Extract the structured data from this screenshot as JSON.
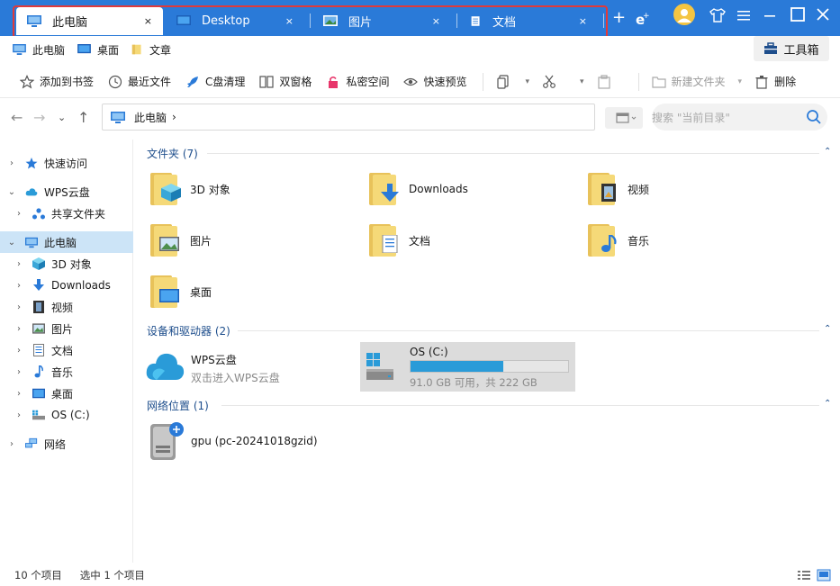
{
  "tabs": [
    {
      "label": "此电脑",
      "close": "×",
      "icon": "computer-icon"
    },
    {
      "label": "Desktop",
      "close": "×",
      "icon": "desktop-icon"
    },
    {
      "label": "图片",
      "close": "×",
      "icon": "pictures-icon"
    },
    {
      "label": "文档",
      "close": "×",
      "icon": "document-icon"
    }
  ],
  "titlebar": {
    "new_tab": "+",
    "accent": "#2a7ad8",
    "highlight": "#e03a3a"
  },
  "bookmarks": [
    {
      "label": "此电脑",
      "icon": "computer-icon"
    },
    {
      "label": "桌面",
      "icon": "desktop-icon"
    },
    {
      "label": "文章",
      "icon": "folder-icon"
    }
  ],
  "toolbox_label": "工具箱",
  "commands": [
    {
      "label": "添加到书签",
      "icon": "star-icon"
    },
    {
      "label": "最近文件",
      "icon": "clock-icon"
    },
    {
      "label": "C盘清理",
      "icon": "rocket-icon"
    },
    {
      "label": "双窗格",
      "icon": "dual-pane-icon"
    },
    {
      "label": "私密空间",
      "icon": "lock-icon"
    },
    {
      "label": "快速预览",
      "icon": "eye-icon"
    }
  ],
  "commands_right": {
    "new_folder": "新建文件夹",
    "delete": "删除"
  },
  "address": {
    "path": "此电脑",
    "separator": "›"
  },
  "search": {
    "placeholder": "搜索 \"当前目录\""
  },
  "sidebar": [
    {
      "label": "快速访问",
      "chev": "›",
      "icon": "star-icon"
    },
    {
      "label": "WPS云盘",
      "chev": "⌄",
      "icon": "cloud-icon"
    },
    {
      "label": "共享文件夹",
      "chev": "›",
      "icon": "share-icon"
    },
    {
      "label": "此电脑",
      "chev": "⌄",
      "icon": "computer-icon"
    },
    {
      "label": "3D 对象",
      "chev": "›",
      "icon": "cube-icon"
    },
    {
      "label": "Downloads",
      "chev": "›",
      "icon": "download-icon"
    },
    {
      "label": "视频",
      "chev": "›",
      "icon": "video-icon"
    },
    {
      "label": "图片",
      "chev": "›",
      "icon": "pictures-icon"
    },
    {
      "label": "文档",
      "chev": "›",
      "icon": "document-icon"
    },
    {
      "label": "音乐",
      "chev": "›",
      "icon": "music-icon"
    },
    {
      "label": "桌面",
      "chev": "›",
      "icon": "desktop-icon"
    },
    {
      "label": "OS (C:)",
      "chev": "›",
      "icon": "drive-icon"
    },
    {
      "label": "网络",
      "chev": "›",
      "icon": "network-icon"
    }
  ],
  "groups": {
    "folders": "文件夹 (7)",
    "devices": "设备和驱动器 (2)",
    "network": "网络位置 (1)"
  },
  "folders": [
    {
      "label": "3D 对象",
      "icon": "cube-icon"
    },
    {
      "label": "Downloads",
      "icon": "download-icon"
    },
    {
      "label": "视频",
      "icon": "video-icon"
    },
    {
      "label": "图片",
      "icon": "pictures-icon"
    },
    {
      "label": "文档",
      "icon": "document-icon"
    },
    {
      "label": "音乐",
      "icon": "music-icon"
    },
    {
      "label": "桌面",
      "icon": "desktop-icon"
    }
  ],
  "devices": {
    "wps": {
      "name": "WPS云盘",
      "sub": "双击进入WPS云盘"
    },
    "os": {
      "name": "OS (C:)",
      "used_fraction": 0.59,
      "sub": "91.0 GB 可用，共 222 GB"
    }
  },
  "network_items": [
    {
      "label": "gpu (pc-20241018gzid)"
    }
  ],
  "status": {
    "count": "10 个项目",
    "selected": "选中 1 个项目"
  }
}
